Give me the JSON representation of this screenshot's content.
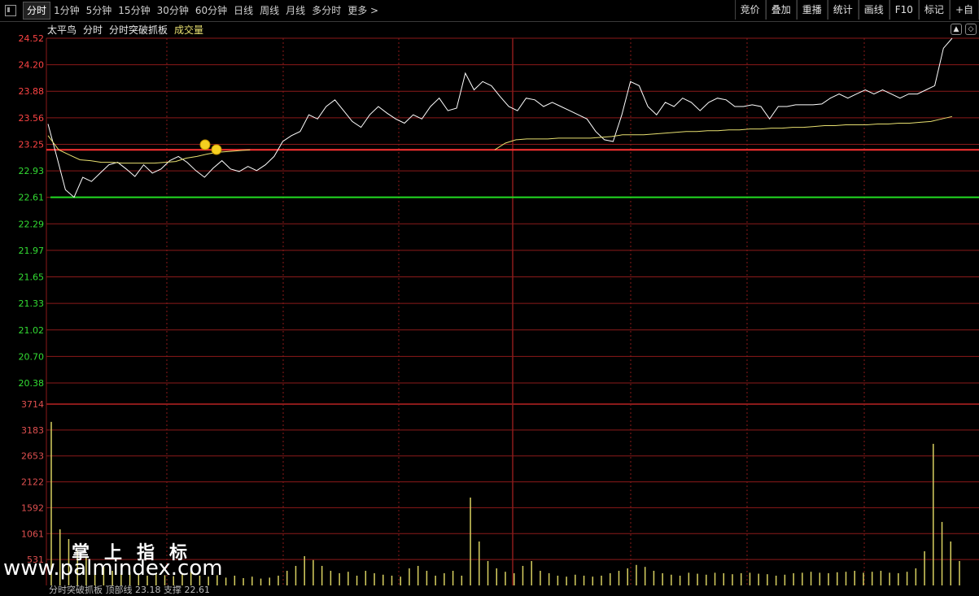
{
  "toolbar": {
    "periods": [
      "分时",
      "1分钟",
      "5分钟",
      "15分钟",
      "30分钟",
      "60分钟",
      "日线",
      "周线",
      "月线",
      "多分时",
      "更多 >"
    ],
    "tools": [
      "竞价",
      "叠加",
      "重播",
      "统计",
      "画线",
      "F10",
      "标记",
      "+自"
    ]
  },
  "chart_header": {
    "stock_name": "太平鸟",
    "mode": "分时",
    "indicator": "分时突破抓板",
    "volume_label": "成交量"
  },
  "corner_buttons": [
    "▲",
    "◇"
  ],
  "colors": {
    "price_line": "#ffffff",
    "avg_line": "#e8e070",
    "grid": "#8b1a1a",
    "support": "#22dd22",
    "resistance": "#ff3333",
    "volume": "#d8d060"
  },
  "chart_data": {
    "type": "line",
    "price_ticks": [
      "24.52",
      "24.20",
      "23.88",
      "23.56",
      "23.25",
      "22.93",
      "22.61",
      "22.29",
      "21.97",
      "21.65",
      "21.33",
      "21.02",
      "20.70",
      "20.38"
    ],
    "volume_ticks": [
      "3714",
      "3183",
      "2653",
      "2122",
      "1592",
      "1061",
      "531"
    ],
    "ylim": [
      20.38,
      24.52
    ],
    "resistance_level": 23.18,
    "support_level": 22.61,
    "price_series": [
      23.49,
      23.1,
      22.7,
      22.61,
      22.85,
      22.8,
      22.9,
      23.0,
      23.03,
      22.95,
      22.86,
      23.0,
      22.9,
      22.95,
      23.05,
      23.1,
      23.03,
      22.93,
      22.85,
      22.96,
      23.05,
      22.95,
      22.92,
      22.98,
      22.93,
      23.0,
      23.1,
      23.28,
      23.35,
      23.4,
      23.6,
      23.55,
      23.7,
      23.78,
      23.65,
      23.52,
      23.45,
      23.6,
      23.7,
      23.62,
      23.55,
      23.5,
      23.6,
      23.55,
      23.7,
      23.8,
      23.65,
      23.68,
      24.1,
      23.9,
      24.0,
      23.95,
      23.82,
      23.7,
      23.65,
      23.8,
      23.78,
      23.7,
      23.75,
      23.7,
      23.65,
      23.6,
      23.55,
      23.4,
      23.3,
      23.28,
      23.6,
      24.0,
      23.95,
      23.7,
      23.6,
      23.75,
      23.7,
      23.8,
      23.75,
      23.65,
      23.75,
      23.8,
      23.78,
      23.7,
      23.7,
      23.72,
      23.7,
      23.55,
      23.7,
      23.7,
      23.72,
      23.72,
      23.72,
      23.73,
      23.8,
      23.85,
      23.8,
      23.85,
      23.9,
      23.85,
      23.9,
      23.85,
      23.8,
      23.85,
      23.85,
      23.9,
      23.95,
      24.4,
      24.52
    ],
    "avg_series": [
      23.35,
      23.18,
      23.12,
      23.06,
      23.05,
      23.03,
      23.03,
      23.02,
      23.02,
      23.02,
      23.02,
      23.03,
      23.04,
      23.08,
      23.1,
      23.13,
      23.15,
      23.16,
      23.17,
      23.18,
      null,
      null,
      null,
      null,
      null,
      null,
      null,
      null,
      null,
      null,
      null,
      null,
      null,
      null,
      null,
      null,
      null,
      null,
      null,
      null,
      null,
      null,
      23.18,
      23.26,
      23.3,
      23.31,
      23.31,
      23.31,
      23.32,
      23.32,
      23.32,
      23.32,
      23.33,
      23.34,
      23.36,
      23.36,
      23.36,
      23.37,
      23.38,
      23.39,
      23.4,
      23.4,
      23.41,
      23.41,
      23.42,
      23.42,
      23.43,
      23.43,
      23.44,
      23.44,
      23.45,
      23.45,
      23.46,
      23.47,
      23.47,
      23.48,
      23.48,
      23.48,
      23.49,
      23.49,
      23.5,
      23.5,
      23.51,
      23.52,
      23.55,
      23.58
    ],
    "volume_series": [
      3350,
      1150,
      950,
      700,
      580,
      450,
      380,
      300,
      250,
      280,
      220,
      200,
      260,
      210,
      190,
      240,
      300,
      200,
      180,
      210,
      160,
      200,
      150,
      180,
      140,
      160,
      200,
      300,
      400,
      600,
      520,
      400,
      300,
      250,
      280,
      200,
      300,
      250,
      220,
      200,
      180,
      350,
      400,
      300,
      200,
      250,
      300,
      200,
      1800,
      900,
      500,
      350,
      280,
      250,
      400,
      500,
      300,
      250,
      200,
      180,
      220,
      200,
      180,
      200,
      250,
      300,
      350,
      420,
      380,
      300,
      250,
      220,
      200,
      260,
      240,
      220,
      260,
      250,
      230,
      250,
      260,
      240,
      230,
      200,
      220,
      250,
      260,
      280,
      260,
      250,
      270,
      280,
      300,
      260,
      280,
      300,
      260,
      250,
      280,
      350,
      700,
      2900,
      1300,
      900,
      500
    ]
  },
  "watermark": {
    "cn": "掌上指标",
    "url": "www.palmindex.com"
  },
  "footer_text": "分时突破抓板 顶部线 23.18 支撑 22.61"
}
